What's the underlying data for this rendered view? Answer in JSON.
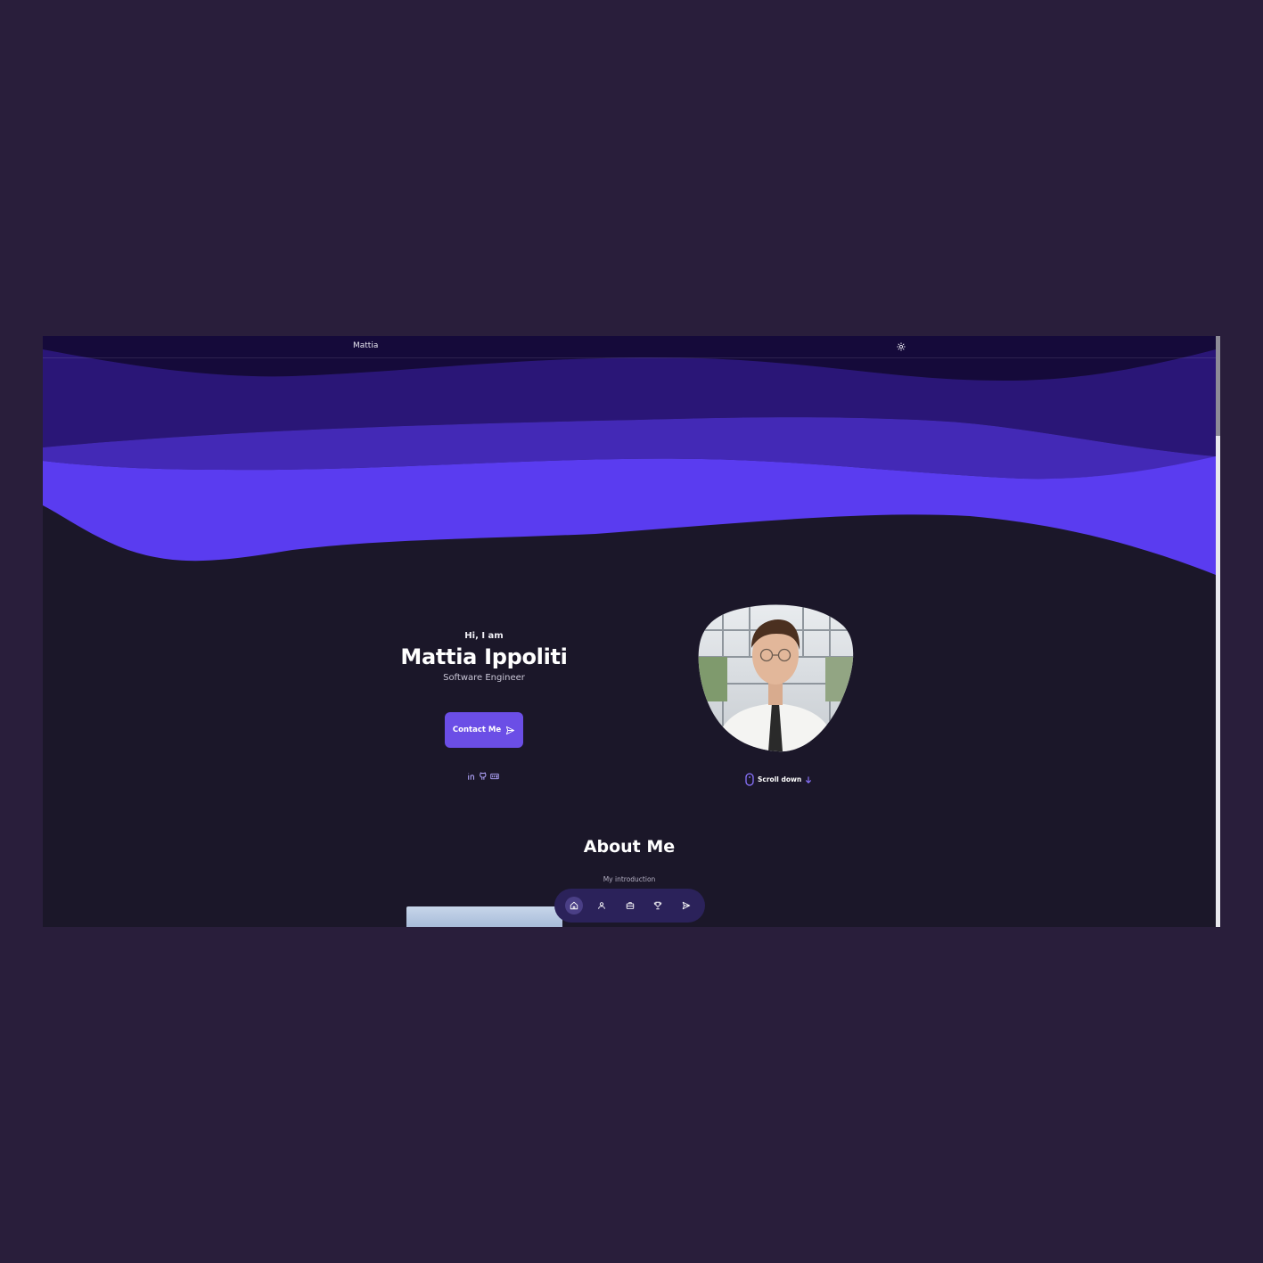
{
  "header": {
    "logo": "Mattia",
    "theme_toggle_icon": "sun-icon"
  },
  "hero": {
    "greeting": "Hi, I am",
    "name": "Mattia Ippoliti",
    "role": "Software Engineer",
    "contact_button": {
      "label": "Contact Me",
      "icon": "send-icon"
    },
    "socials": [
      {
        "name": "linkedin",
        "icon": "linkedin-icon"
      },
      {
        "name": "github",
        "icon": "github-icon"
      },
      {
        "name": "dev",
        "icon": "dev-icon"
      }
    ],
    "scroll_label": "Scroll down"
  },
  "about": {
    "title": "About Me",
    "subtitle": "My introduction"
  },
  "bottom_nav": {
    "items": [
      {
        "icon": "home-icon",
        "active": true
      },
      {
        "icon": "user-icon",
        "active": false
      },
      {
        "icon": "briefcase-icon",
        "active": false
      },
      {
        "icon": "trophy-icon",
        "active": false
      },
      {
        "icon": "send-icon",
        "active": false
      }
    ]
  },
  "colors": {
    "page_bg": "#291e3b",
    "screen_bg": "#1b1729",
    "accent": "#6b4ee6",
    "wave_1": "#150a3a",
    "wave_2": "#2a1677",
    "wave_3": "#4329b6",
    "wave_4": "#5a3cf0",
    "nav_bg": "#2b225a"
  }
}
